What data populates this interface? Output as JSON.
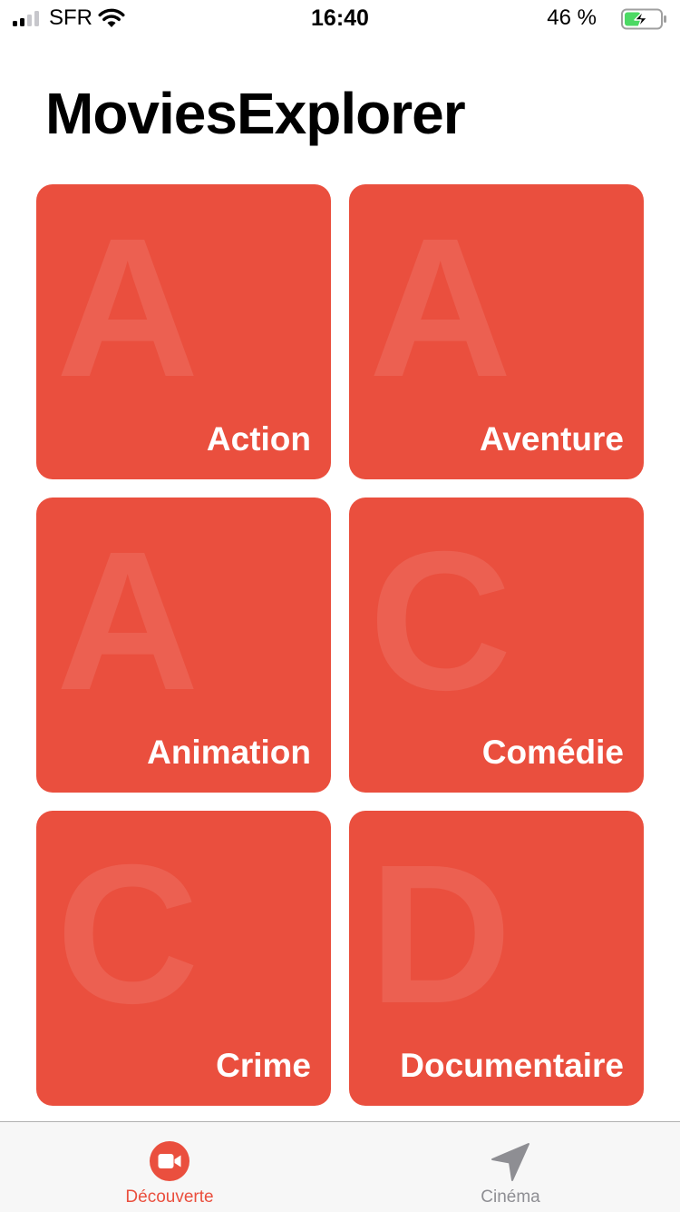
{
  "status_bar": {
    "carrier": "SFR",
    "time": "16:40",
    "battery_percent": "46 %",
    "battery_level": 0.46
  },
  "app_title": "MoviesExplorer",
  "genres": [
    {
      "letter": "A",
      "label": "Action"
    },
    {
      "letter": "A",
      "label": "Aventure"
    },
    {
      "letter": "A",
      "label": "Animation"
    },
    {
      "letter": "C",
      "label": "Comédie"
    },
    {
      "letter": "C",
      "label": "Crime"
    },
    {
      "letter": "D",
      "label": "Documentaire"
    }
  ],
  "tab_bar": {
    "tabs": [
      {
        "label": "Découverte",
        "icon": "video-camera-icon",
        "selected": true
      },
      {
        "label": "Cinéma",
        "icon": "location-arrow-icon",
        "selected": false
      }
    ]
  },
  "colors": {
    "accent": "#ea4f3e",
    "tab_inactive": "#8e8e93",
    "battery_fill": "#4cd964"
  }
}
